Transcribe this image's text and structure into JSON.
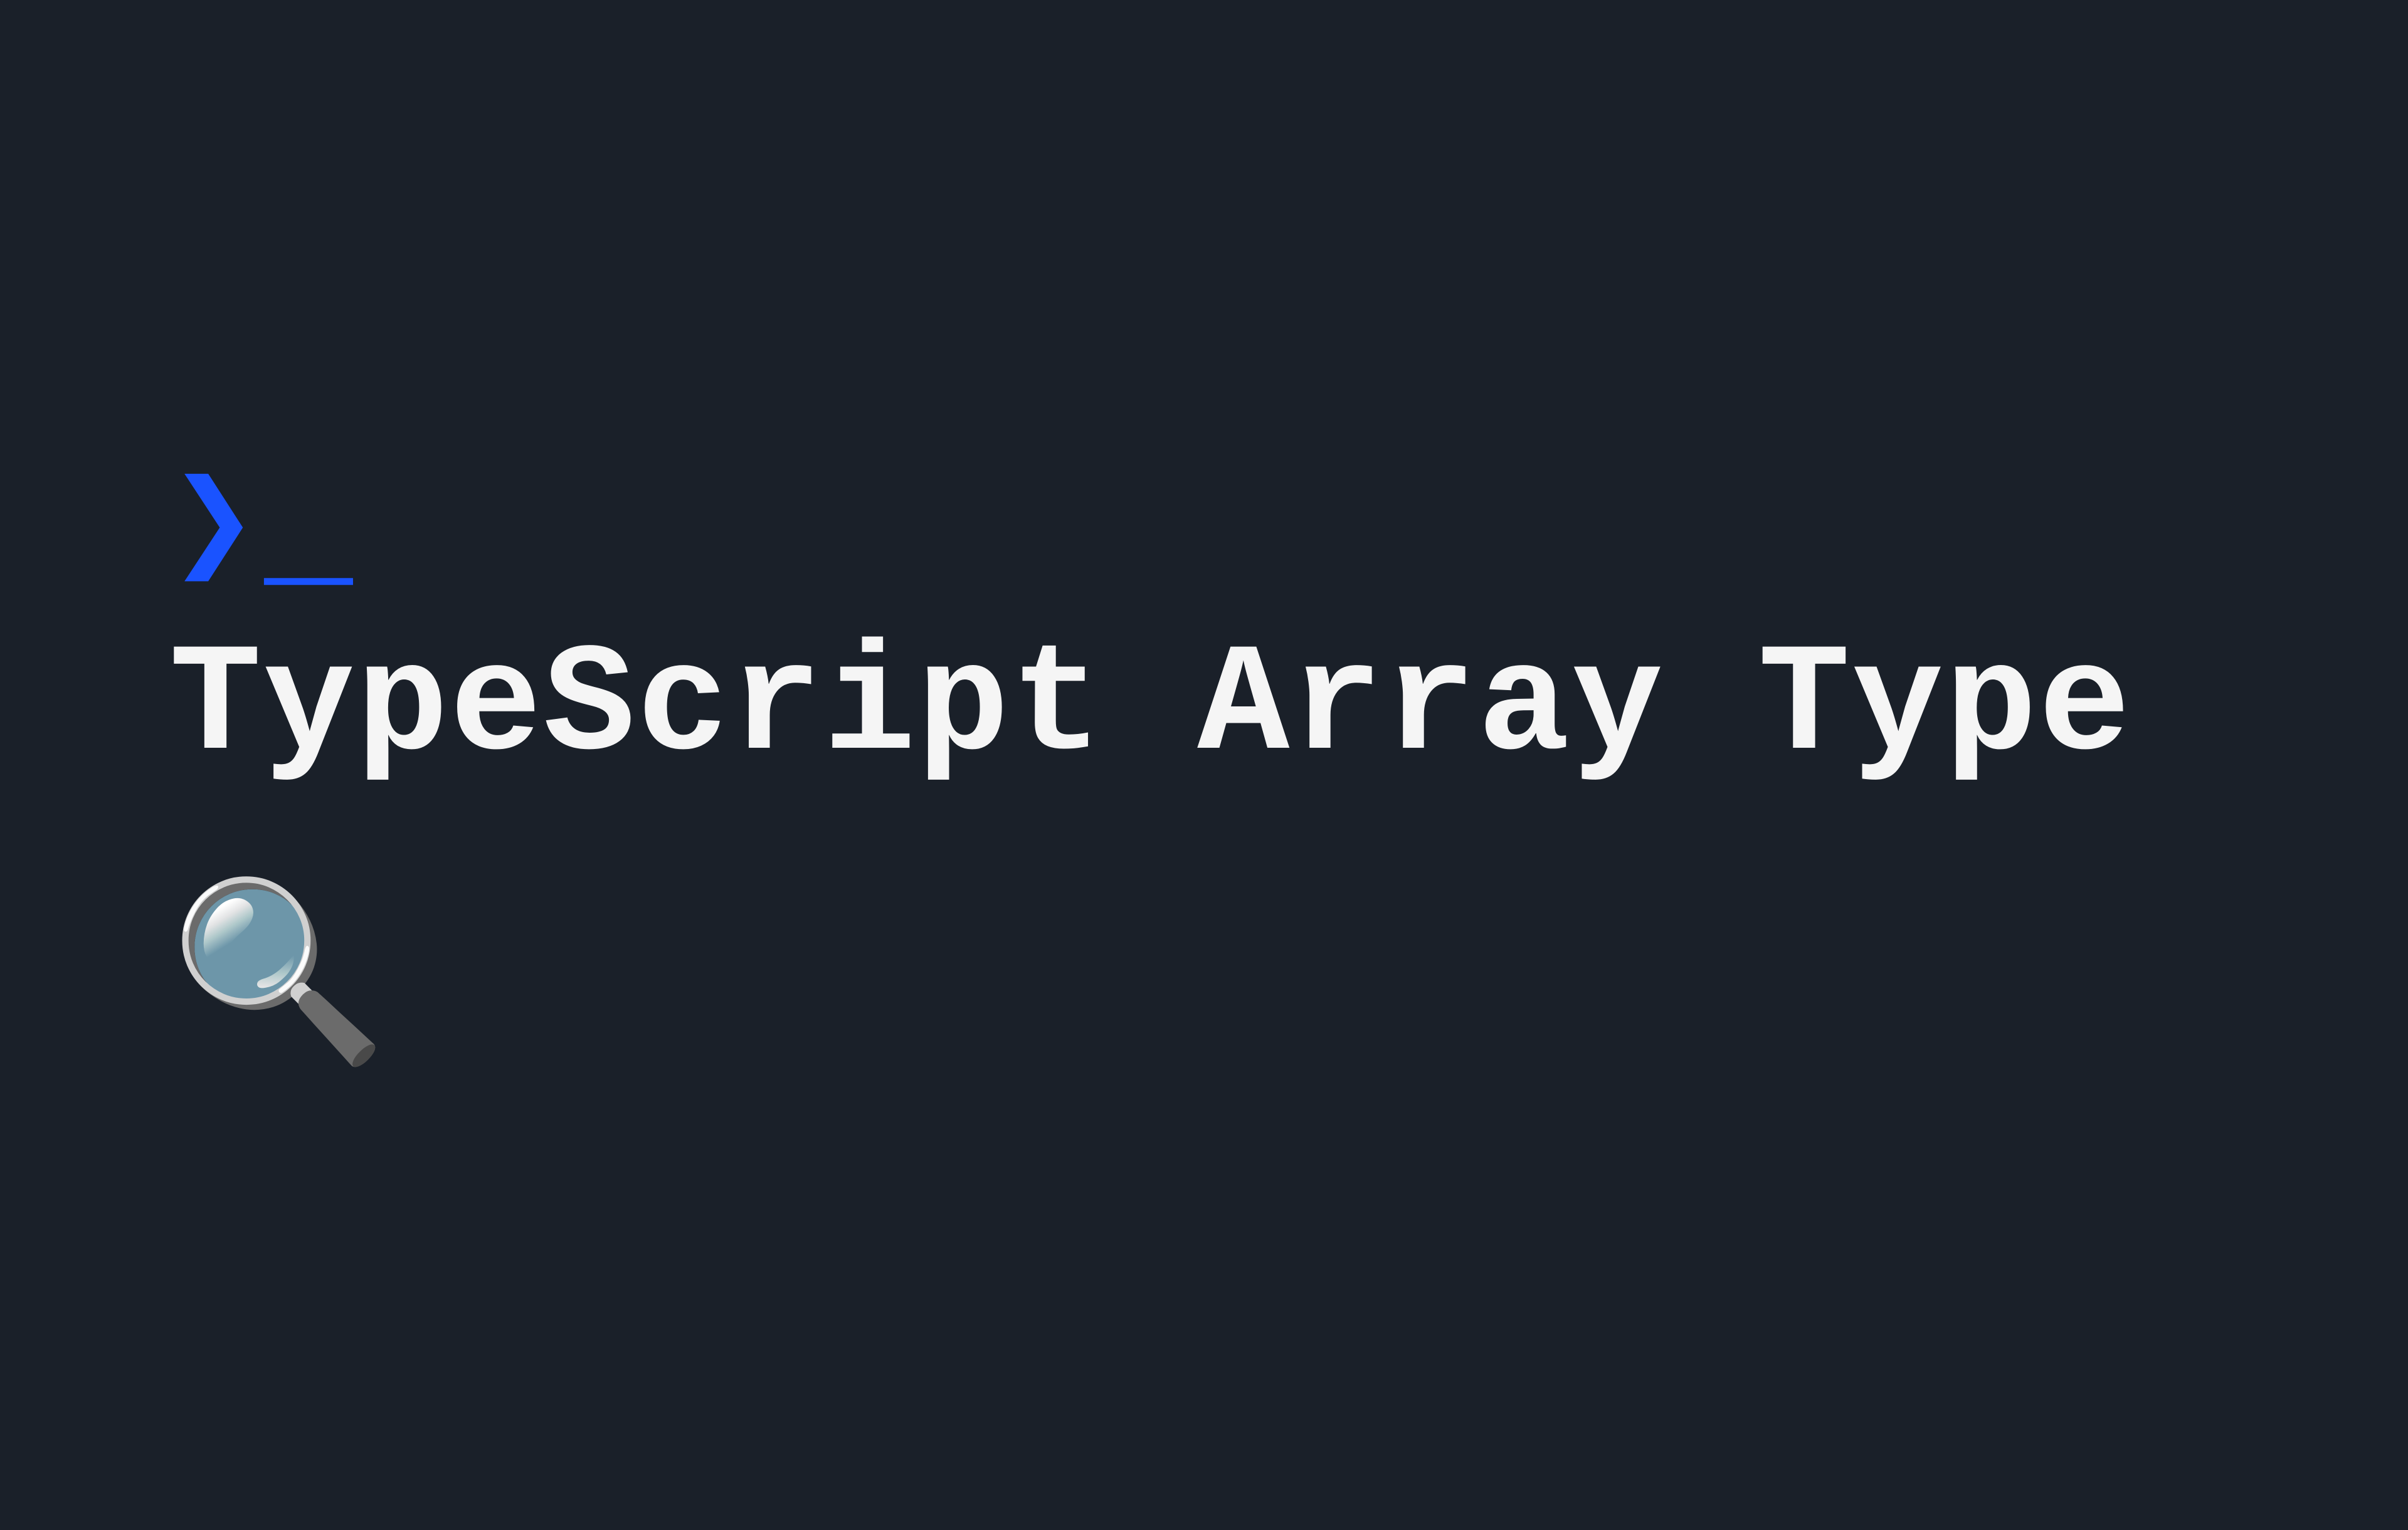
{
  "prompt": {
    "chevron": "❯",
    "underscore": "_"
  },
  "title": {
    "text": "TypeScript Array Type"
  },
  "icon": {
    "magnifier": "🔍"
  },
  "colors": {
    "background": "#1a2029",
    "accent": "#1a53ff",
    "text": "#f5f5f5"
  }
}
